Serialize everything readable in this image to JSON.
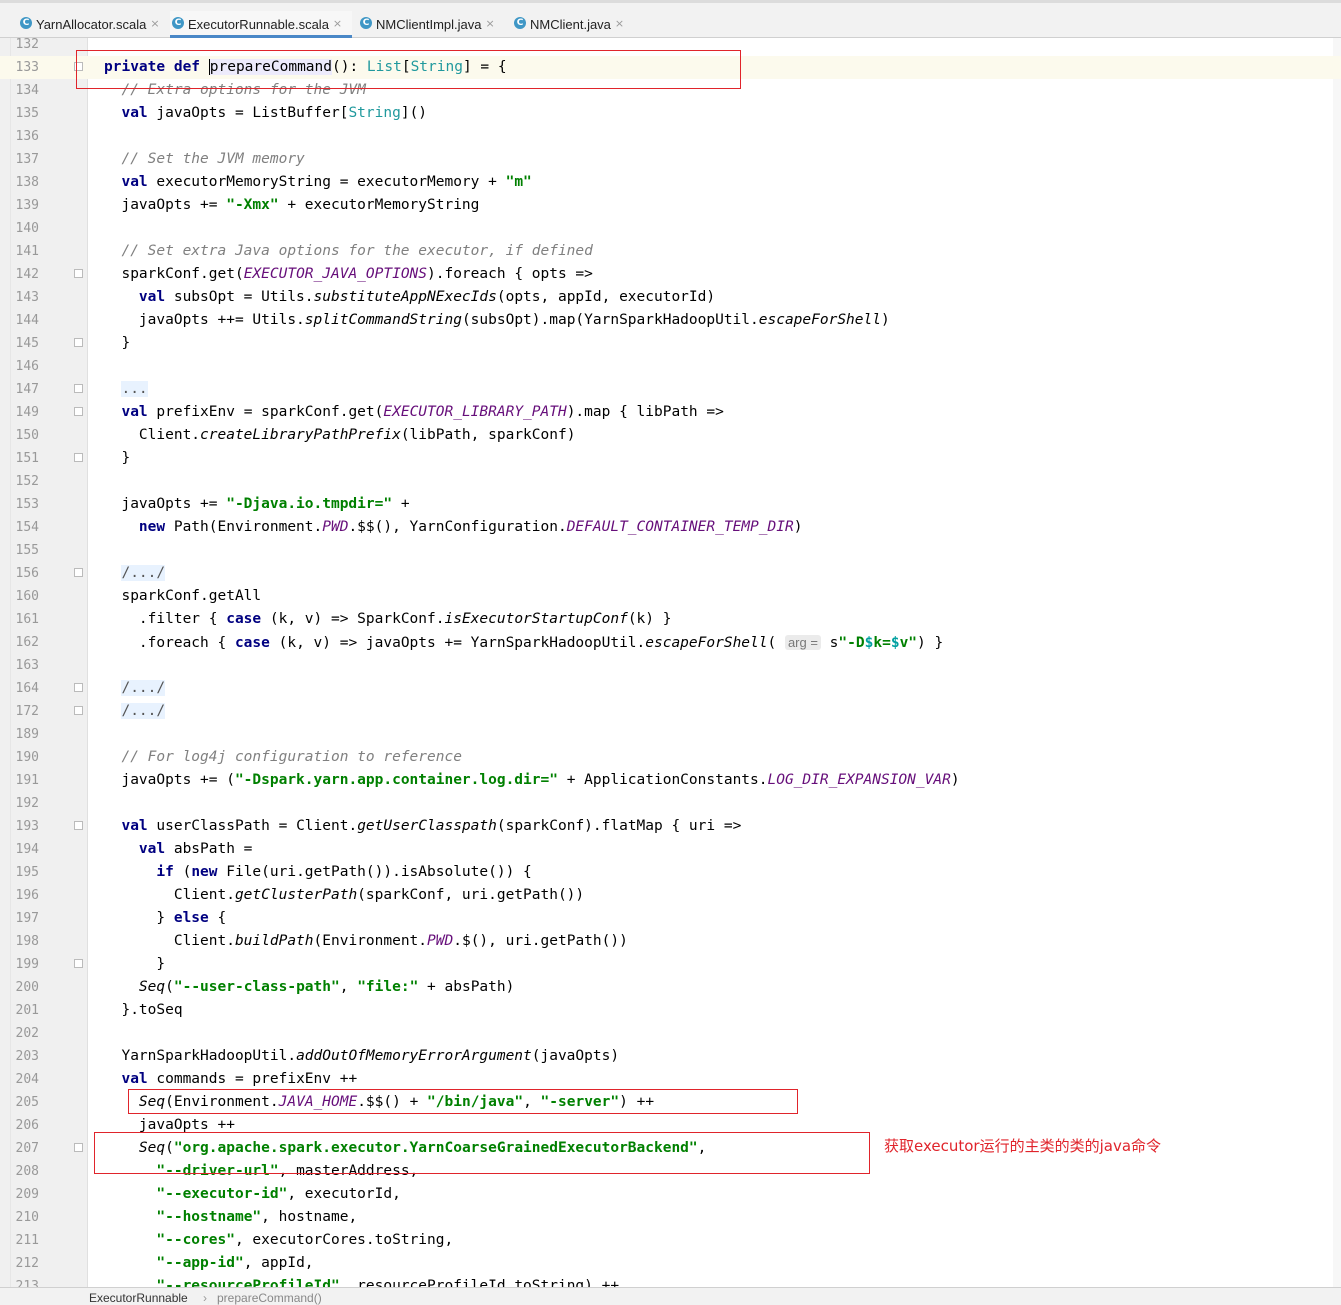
{
  "tabs": [
    {
      "label": "YarnAllocator.scala",
      "icon_letter": "C",
      "active": false
    },
    {
      "label": "ExecutorRunnable.scala",
      "icon_letter": "C",
      "active": true
    },
    {
      "label": "NMClientImpl.java",
      "icon_letter": "C",
      "active": false
    },
    {
      "label": "NMClient.java",
      "icon_letter": "C",
      "active": false
    }
  ],
  "tab_close_glyph": "×",
  "lines": [
    {
      "num": "132",
      "t": []
    },
    {
      "num": "133",
      "t": [
        [
          "kw",
          "private def "
        ],
        [
          "caret",
          ""
        ],
        [
          "hl",
          "prepareCommand"
        ],
        [
          "",
          "(): "
        ],
        [
          "typ",
          "List"
        ],
        [
          "",
          "["
        ],
        [
          "typ",
          "String"
        ],
        [
          "",
          "] = {"
        ]
      ]
    },
    {
      "num": "134",
      "t": [
        [
          "cm",
          "  // Extra options for the JVM"
        ]
      ]
    },
    {
      "num": "135",
      "t": [
        [
          "kw",
          "  val "
        ],
        [
          "",
          "javaOpts = ListBuffer["
        ],
        [
          "typ",
          "String"
        ],
        [
          "",
          "]()"
        ]
      ]
    },
    {
      "num": "136",
      "t": []
    },
    {
      "num": "137",
      "t": [
        [
          "cm",
          "  // Set the JVM memory"
        ]
      ]
    },
    {
      "num": "138",
      "t": [
        [
          "kw",
          "  val "
        ],
        [
          "",
          "executorMemoryString = executorMemory + "
        ],
        [
          "str",
          "\"m\""
        ]
      ]
    },
    {
      "num": "139",
      "t": [
        [
          "",
          "  javaOpts += "
        ],
        [
          "str",
          "\"-Xmx\""
        ],
        [
          "",
          " + executorMemoryString"
        ]
      ]
    },
    {
      "num": "140",
      "t": []
    },
    {
      "num": "141",
      "t": [
        [
          "cm",
          "  // Set extra Java options for the executor, if defined"
        ]
      ]
    },
    {
      "num": "142",
      "t": [
        [
          "",
          "  sparkConf.get("
        ],
        [
          "cst",
          "EXECUTOR_JAVA_OPTIONS"
        ],
        [
          "",
          ").foreach { opts =>"
        ]
      ]
    },
    {
      "num": "143",
      "t": [
        [
          "kw",
          "    val "
        ],
        [
          "",
          "subsOpt = Utils."
        ],
        [
          "ital",
          "substituteAppNExecIds"
        ],
        [
          "",
          "(opts, appId, executorId)"
        ]
      ]
    },
    {
      "num": "144",
      "t": [
        [
          "",
          "    javaOpts ++= Utils."
        ],
        [
          "ital",
          "splitCommandString"
        ],
        [
          "",
          "(subsOpt).map(YarnSparkHadoopUtil."
        ],
        [
          "ital",
          "escapeForShell"
        ],
        [
          "",
          ")"
        ]
      ]
    },
    {
      "num": "145",
      "t": [
        [
          "",
          "  }"
        ]
      ]
    },
    {
      "num": "146",
      "t": []
    },
    {
      "num": "147",
      "t": [
        [
          "",
          "  "
        ],
        [
          "folded",
          "..."
        ]
      ]
    },
    {
      "num": "149",
      "t": [
        [
          "kw",
          "  val "
        ],
        [
          "",
          "prefixEnv = sparkConf.get("
        ],
        [
          "cst",
          "EXECUTOR_LIBRARY_PATH"
        ],
        [
          "",
          ").map { libPath =>"
        ]
      ]
    },
    {
      "num": "150",
      "t": [
        [
          "",
          "    Client."
        ],
        [
          "ital",
          "createLibraryPathPrefix"
        ],
        [
          "",
          "(libPath, sparkConf)"
        ]
      ]
    },
    {
      "num": "151",
      "t": [
        [
          "",
          "  }"
        ]
      ]
    },
    {
      "num": "152",
      "t": []
    },
    {
      "num": "153",
      "t": [
        [
          "",
          "  javaOpts += "
        ],
        [
          "str",
          "\"-Djava.io.tmpdir=\""
        ],
        [
          "",
          " +"
        ]
      ]
    },
    {
      "num": "154",
      "t": [
        [
          "kw",
          "    new "
        ],
        [
          "",
          "Path(Environment."
        ],
        [
          "cst",
          "PWD"
        ],
        [
          "",
          ".$$(), YarnConfiguration."
        ],
        [
          "cst",
          "DEFAULT_CONTAINER_TEMP_DIR"
        ],
        [
          "",
          ")"
        ]
      ]
    },
    {
      "num": "155",
      "t": []
    },
    {
      "num": "156",
      "t": [
        [
          "",
          "  "
        ],
        [
          "folded",
          "/.../"
        ]
      ]
    },
    {
      "num": "160",
      "t": [
        [
          "",
          "  sparkConf.getAll"
        ]
      ]
    },
    {
      "num": "161",
      "t": [
        [
          "",
          "    .filter { "
        ],
        [
          "kw",
          "case "
        ],
        [
          "",
          "(k, v) => SparkConf."
        ],
        [
          "ital",
          "isExecutorStartupConf"
        ],
        [
          "",
          "(k) }"
        ]
      ]
    },
    {
      "num": "162",
      "t": [
        [
          "",
          "    .foreach { "
        ],
        [
          "kw",
          "case "
        ],
        [
          "",
          "(k, v) => javaOpts += YarnSparkHadoopUtil."
        ],
        [
          "ital",
          "escapeForShell"
        ],
        [
          "",
          "( "
        ],
        [
          "hint",
          "arg ="
        ],
        [
          "",
          " s"
        ],
        [
          "interp",
          "\"-D"
        ],
        [
          "interp-v",
          "$"
        ],
        [
          "interp",
          "k="
        ],
        [
          "interp-v",
          "$"
        ],
        [
          "interp",
          "v\""
        ],
        [
          "",
          ") }"
        ]
      ]
    },
    {
      "num": "163",
      "t": []
    },
    {
      "num": "164",
      "t": [
        [
          "",
          "  "
        ],
        [
          "folded",
          "/.../"
        ]
      ]
    },
    {
      "num": "172",
      "t": [
        [
          "",
          "  "
        ],
        [
          "folded",
          "/.../"
        ]
      ]
    },
    {
      "num": "189",
      "t": []
    },
    {
      "num": "190",
      "t": [
        [
          "cm",
          "  // For log4j configuration to reference"
        ]
      ]
    },
    {
      "num": "191",
      "t": [
        [
          "",
          "  javaOpts += ("
        ],
        [
          "str",
          "\"-Dspark.yarn.app.container.log.dir=\""
        ],
        [
          "",
          " + ApplicationConstants."
        ],
        [
          "cst",
          "LOG_DIR_EXPANSION_VAR"
        ],
        [
          "",
          ")"
        ]
      ]
    },
    {
      "num": "192",
      "t": []
    },
    {
      "num": "193",
      "t": [
        [
          "kw",
          "  val "
        ],
        [
          "",
          "userClassPath = Client."
        ],
        [
          "ital",
          "getUserClasspath"
        ],
        [
          "",
          "(sparkConf).flatMap { uri =>"
        ]
      ]
    },
    {
      "num": "194",
      "t": [
        [
          "kw",
          "    val "
        ],
        [
          "",
          "absPath ="
        ]
      ]
    },
    {
      "num": "195",
      "t": [
        [
          "kw",
          "      if "
        ],
        [
          "",
          "("
        ],
        [
          "kw",
          "new "
        ],
        [
          "",
          "File(uri.getPath()).isAbsolute()) {"
        ]
      ]
    },
    {
      "num": "196",
      "t": [
        [
          "",
          "        Client."
        ],
        [
          "ital",
          "getClusterPath"
        ],
        [
          "",
          "(sparkConf, uri.getPath())"
        ]
      ]
    },
    {
      "num": "197",
      "t": [
        [
          "",
          "      } "
        ],
        [
          "kw",
          "else "
        ],
        [
          "",
          "{"
        ]
      ]
    },
    {
      "num": "198",
      "t": [
        [
          "",
          "        Client."
        ],
        [
          "ital",
          "buildPath"
        ],
        [
          "",
          "(Environment."
        ],
        [
          "cst",
          "PWD"
        ],
        [
          "",
          ".$(), uri.getPath())"
        ]
      ]
    },
    {
      "num": "199",
      "t": [
        [
          "",
          "      }"
        ]
      ]
    },
    {
      "num": "200",
      "t": [
        [
          "",
          "    "
        ],
        [
          "ital",
          "Seq"
        ],
        [
          "",
          "("
        ],
        [
          "str",
          "\"--user-class-path\""
        ],
        [
          "",
          ", "
        ],
        [
          "str",
          "\"file:\""
        ],
        [
          "",
          " + absPath)"
        ]
      ]
    },
    {
      "num": "201",
      "t": [
        [
          "",
          "  }.toSeq"
        ]
      ]
    },
    {
      "num": "202",
      "t": []
    },
    {
      "num": "203",
      "t": [
        [
          "",
          "  YarnSparkHadoopUtil."
        ],
        [
          "ital",
          "addOutOfMemoryErrorArgument"
        ],
        [
          "",
          "(javaOpts)"
        ]
      ]
    },
    {
      "num": "204",
      "t": [
        [
          "kw",
          "  val "
        ],
        [
          "",
          "commands = prefixEnv ++"
        ]
      ]
    },
    {
      "num": "205",
      "t": [
        [
          "",
          "    "
        ],
        [
          "ital",
          "Seq"
        ],
        [
          "",
          "(Environment."
        ],
        [
          "cst",
          "JAVA_HOME"
        ],
        [
          "",
          ".$$() + "
        ],
        [
          "str",
          "\"/bin/java\""
        ],
        [
          "",
          ", "
        ],
        [
          "str",
          "\"-server\""
        ],
        [
          "",
          ") ++"
        ]
      ]
    },
    {
      "num": "206",
      "t": [
        [
          "",
          "    javaOpts ++"
        ]
      ]
    },
    {
      "num": "207",
      "t": [
        [
          "",
          "    "
        ],
        [
          "ital",
          "Seq"
        ],
        [
          "",
          "("
        ],
        [
          "str",
          "\"org.apache.spark.executor.YarnCoarseGrainedExecutorBackend\""
        ],
        [
          "",
          ","
        ]
      ]
    },
    {
      "num": "208",
      "t": [
        [
          "",
          "      "
        ],
        [
          "str",
          "\"--driver-url\""
        ],
        [
          "",
          ", masterAddress,"
        ]
      ]
    },
    {
      "num": "209",
      "t": [
        [
          "",
          "      "
        ],
        [
          "str",
          "\"--executor-id\""
        ],
        [
          "",
          ", executorId,"
        ]
      ]
    },
    {
      "num": "210",
      "t": [
        [
          "",
          "      "
        ],
        [
          "str",
          "\"--hostname\""
        ],
        [
          "",
          ", hostname,"
        ]
      ]
    },
    {
      "num": "211",
      "t": [
        [
          "",
          "      "
        ],
        [
          "str",
          "\"--cores\""
        ],
        [
          "",
          ", executorCores.toString,"
        ]
      ]
    },
    {
      "num": "212",
      "t": [
        [
          "",
          "      "
        ],
        [
          "str",
          "\"--app-id\""
        ],
        [
          "",
          ", appId,"
        ]
      ]
    },
    {
      "num": "213",
      "t": [
        [
          "",
          "      "
        ],
        [
          "str",
          "\"--resourceProfileId\""
        ],
        [
          "",
          ", resourceProfileId.toString) ++"
        ]
      ]
    }
  ],
  "fold_markers": [
    "133",
    "142",
    "145",
    "147",
    "149",
    "151",
    "156",
    "164",
    "172",
    "193",
    "199",
    "207"
  ],
  "current_line": "133",
  "annotation": "获取executor运行的主类的类的java命令",
  "breadcrumb": {
    "file": "ExecutorRunnable",
    "separator": "›",
    "method": "prepareCommand()"
  },
  "colors": {
    "keyword": "#000080",
    "string": "#008000",
    "comment": "#808080",
    "constant": "#660e7a",
    "type": "#20999d",
    "annotation_red": "#e0242b"
  }
}
